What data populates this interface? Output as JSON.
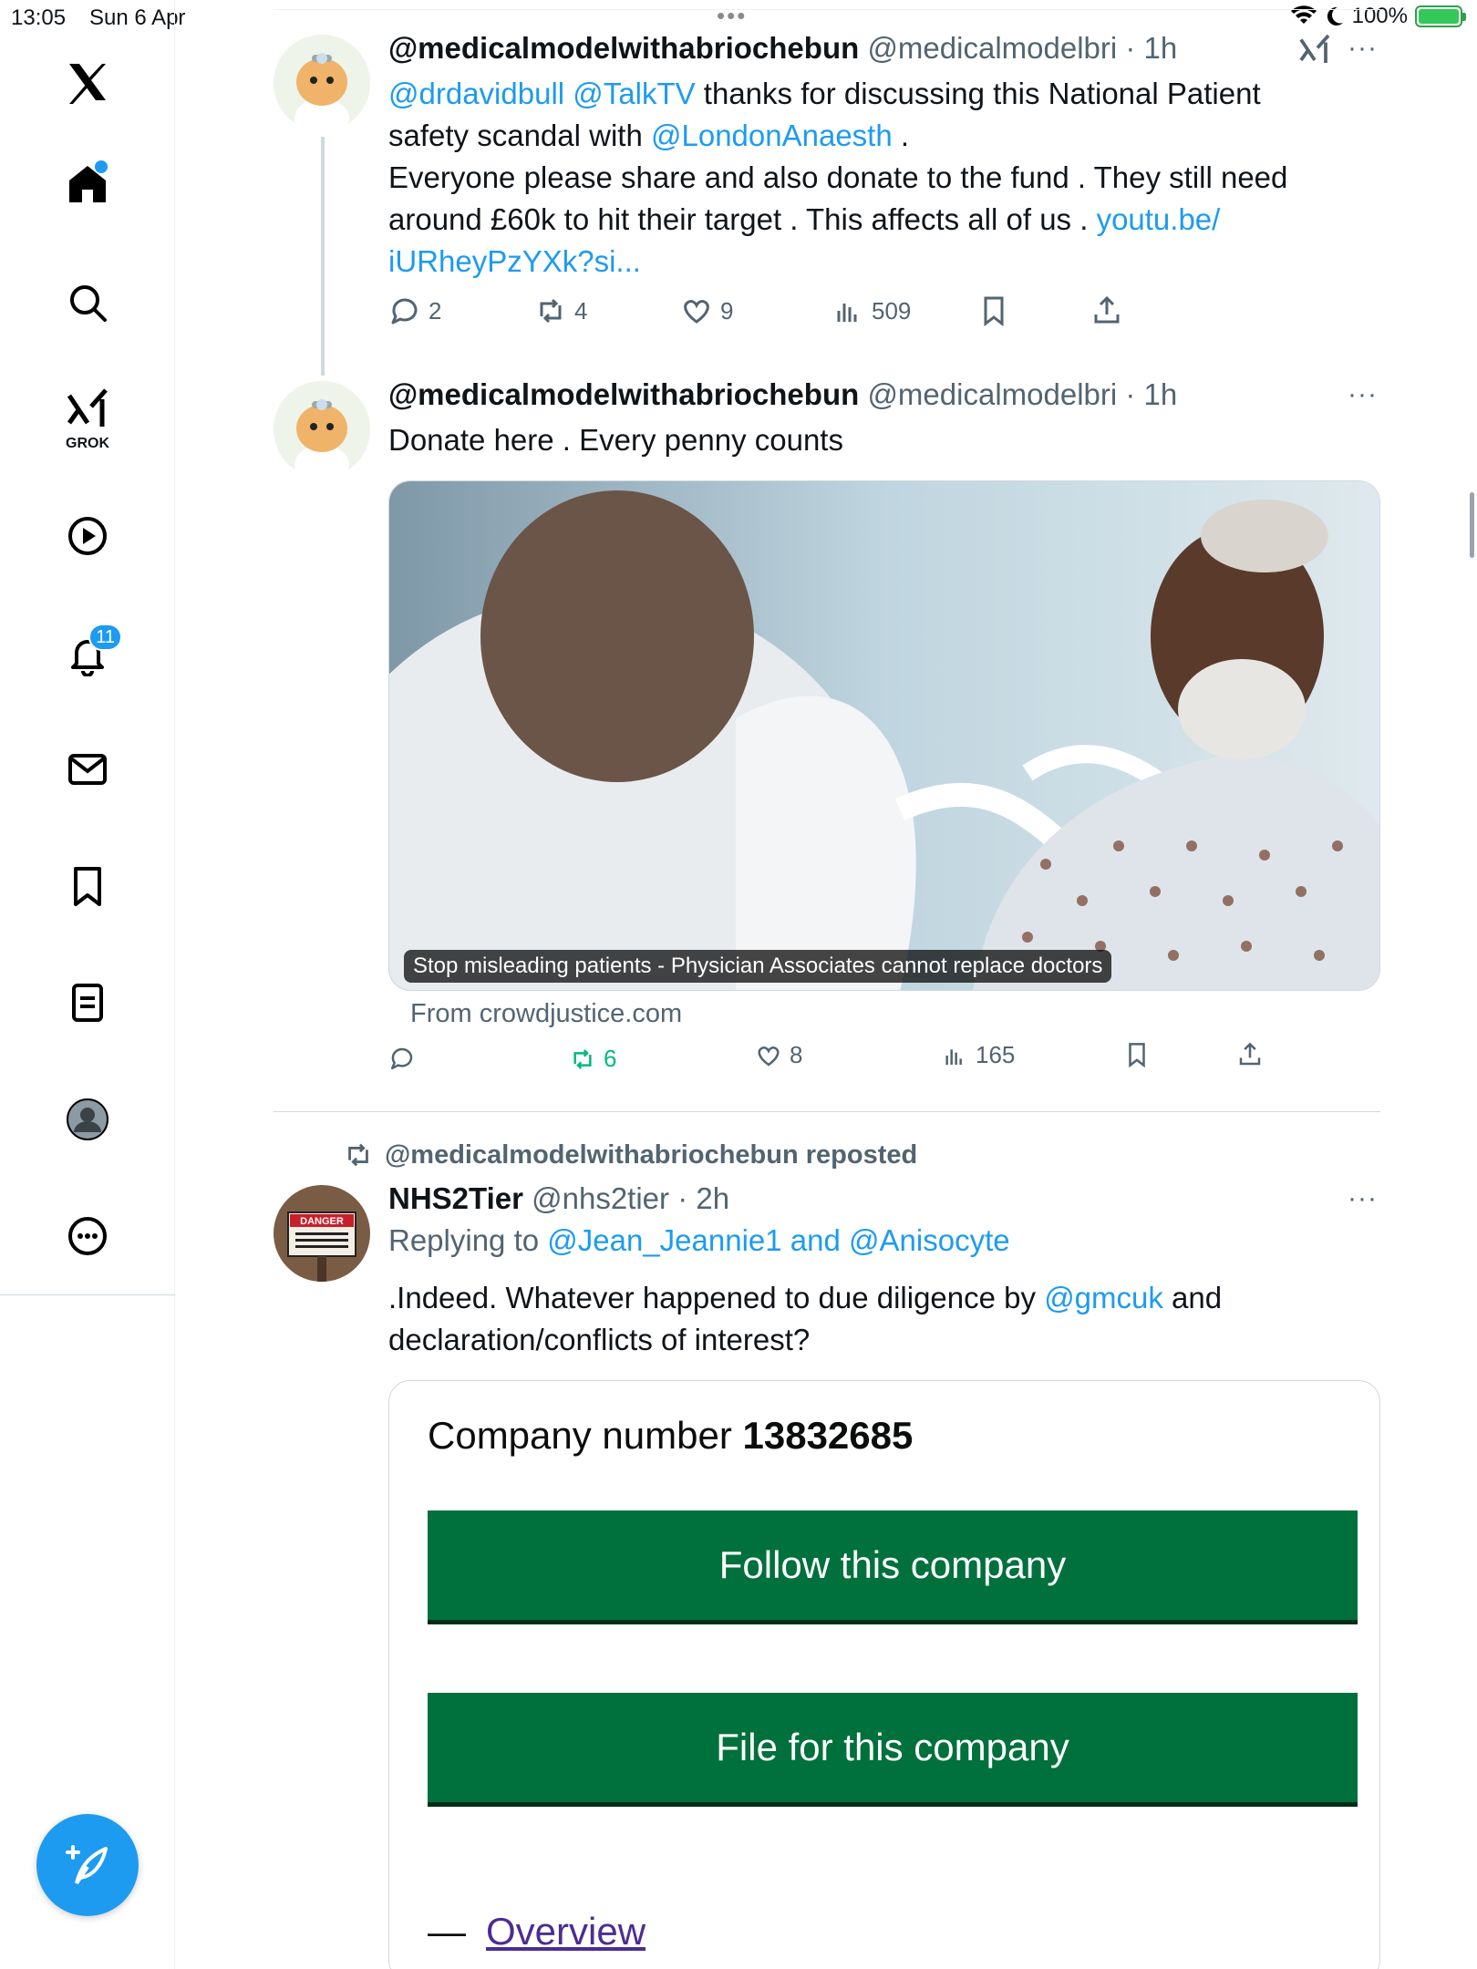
{
  "status_bar": {
    "time": "13:05",
    "date": "Sun 6 Apr",
    "battery": "100%"
  },
  "sidebar": {
    "grok_label": "GROK",
    "notifications_count": "11"
  },
  "tweets": [
    {
      "display_name": "@medicalmodelwithabriochebun",
      "handle": "@medicalmodelbri",
      "time": "· 1h",
      "text_lines": [
        {
          "parts": [
            {
              "t": "@drdavidbull @TalkTV",
              "link": true
            },
            {
              "t": " thanks for discussing this National Patient",
              "link": false
            }
          ]
        },
        {
          "parts": [
            {
              "t": "safety scandal with ",
              "link": false
            },
            {
              "t": "@LondonAnaesth",
              "link": true
            },
            {
              "t": " .",
              "link": false
            }
          ]
        },
        {
          "parts": [
            {
              "t": "Everyone please share and also donate to the fund . They still need",
              "link": false
            }
          ]
        },
        {
          "parts": [
            {
              "t": "around  £60k to hit their target . This affects all of us . ",
              "link": false
            },
            {
              "t": "youtu.be/",
              "link": true
            }
          ]
        },
        {
          "parts": [
            {
              "t": "iURheyPzYXk?si...",
              "link": true
            }
          ]
        }
      ],
      "replies": "2",
      "reposts": "4",
      "likes": "9",
      "views": "509"
    },
    {
      "display_name": "@medicalmodelwithabriochebun",
      "handle": "@medicalmodelbri",
      "time": "· 1h",
      "text": "Donate here . Every penny counts",
      "media_caption": "Stop misleading patients - Physician Associates cannot replace doctors",
      "media_source": "From crowdjustice.com",
      "replies": "",
      "reposts": "6",
      "likes": "8",
      "views": "165"
    },
    {
      "repost_label": "@medicalmodelwithabriochebun reposted",
      "display_name": "NHS2Tier",
      "handle": "@nhs2tier",
      "time": "· 2h",
      "replying_prefix": "Replying to ",
      "replying_to": "@Jean_Jeannie1 and @Anisocyte",
      "text_line1_a": ".Indeed. Whatever happened to due diligence by ",
      "text_line1_link": "@gmcuk",
      "text_line1_b": " and",
      "text_line2": "declaration/conflicts of interest?",
      "card": {
        "company_label": "Company number",
        "company_number": "13832685",
        "follow_button": "Follow this company",
        "file_button": "File for this company",
        "overview_dash": "—",
        "overview_link": "Overview"
      },
      "avatar_sign_text": "DANGER",
      "avatar_sign_sub": "AUTHORIZED PERSONNEL ONLY BEYOND THIS POINT"
    }
  ],
  "colors": {
    "accent": "#1d9bf0",
    "repost_green": "#00ba7c",
    "gov_green": "#00703c"
  }
}
